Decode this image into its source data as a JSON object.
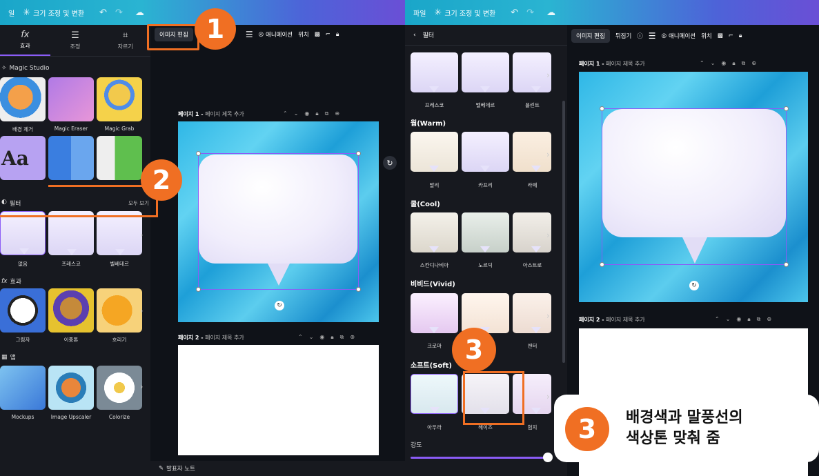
{
  "left": {
    "topbar": {
      "file": "일",
      "resize_label": "크기 조정 및 변환"
    },
    "sidebar": {
      "tabs": [
        {
          "label": "효과",
          "icon": "fx-icon"
        },
        {
          "label": "조정",
          "icon": "sliders-icon"
        },
        {
          "label": "자르기",
          "icon": "crop-icon"
        }
      ],
      "magic_studio": "Magic Studio",
      "magic_items": [
        "배경 제거",
        "Magic Eraser",
        "Magic Grab"
      ],
      "filter_title": "필터",
      "see_all": "모두 보기",
      "filter_items": [
        "없음",
        "프레스코",
        "벨베데르"
      ],
      "effects_title": "효과",
      "effect_items": [
        "그림자",
        "이중톤",
        "흐리기"
      ],
      "apps_title": "앱",
      "app_items": [
        "Mockups",
        "Image Upscaler",
        "Colorize"
      ]
    },
    "toolbar": {
      "edit_image": "이미지 편집",
      "animation": "애니메이션",
      "position": "위치"
    },
    "page1": {
      "label": "페이지 1 -",
      "placeholder": "페이지 제목 추가"
    },
    "page2": {
      "label": "페이지 2 -",
      "placeholder": "페이지 제목 추가"
    },
    "notes": "발표자 노트",
    "markers": [
      "1",
      "2"
    ]
  },
  "right": {
    "topbar": {
      "file": "파일",
      "resize_label": "크기 조정 및 변환"
    },
    "panel": {
      "title": "필터",
      "top_row": [
        "프레스코",
        "벨베데르",
        "플린트"
      ],
      "warm_title": "웜(Warm)",
      "warm_items": [
        "발리",
        "카프리",
        "라떼"
      ],
      "cool_title": "쿨(Cool)",
      "cool_items": [
        "스칸디나비아",
        "노르딕",
        "아스트로"
      ],
      "vivid_title": "비비드(Vivid)",
      "vivid_items": [
        "크로마",
        "",
        "앤터"
      ],
      "soft_title": "소프트(Soft)",
      "soft_items": [
        "아우라",
        "헤이즈",
        "험지"
      ],
      "intensity": "강도"
    },
    "toolbar": {
      "edit_image": "이미지 편집",
      "flip": "뒤집기",
      "animation": "애니메이션",
      "position": "위치"
    },
    "page1": {
      "label": "페이지 1 -",
      "placeholder": "페이지 제목 추가"
    },
    "page2": {
      "label": "페이지 2 -",
      "placeholder": "페이지 제목 추가"
    },
    "marker": "3",
    "callout": {
      "number": "3",
      "line1": "배경색과 말풍선의",
      "line2": "색상톤 맞춰 줌"
    }
  },
  "colors": {
    "accent": "#8b5cf6",
    "orange": "#f06f23"
  }
}
